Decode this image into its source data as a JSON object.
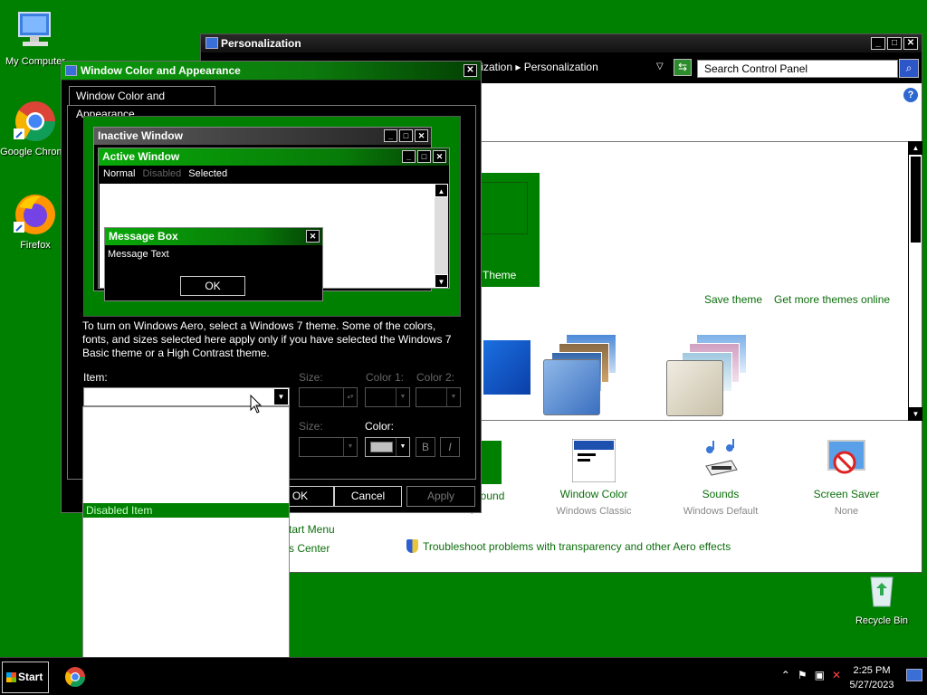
{
  "desktop": {
    "icons": [
      {
        "label": "My Computer",
        "icon": "computer-icon"
      },
      {
        "label": "Google Chrome",
        "icon": "chrome-icon"
      },
      {
        "label": "Firefox",
        "icon": "firefox-icon"
      },
      {
        "label": "Recycle Bin",
        "icon": "recycle-bin-icon"
      }
    ]
  },
  "personalization": {
    "title": "Personalization",
    "breadcrumb": "alization  ▸  Personalization",
    "search_placeholder": "Search Control Panel",
    "theme_tile_label": "Theme",
    "save_theme": "Save theme",
    "get_more_themes": "Get more themes online",
    "categories": [
      {
        "title": "Window Color",
        "subtitle": "Windows Classic"
      },
      {
        "title": "Sounds",
        "subtitle": "Windows Default"
      },
      {
        "title": "Screen Saver",
        "subtitle": "None"
      }
    ],
    "cut_background": "ground",
    "cut_background_sub": "r",
    "cut_start_menu": "tart Menu",
    "cut_center": "s Center",
    "troubleshoot": "Troubleshoot problems with transparency and other Aero effects"
  },
  "dialog": {
    "title": "Window Color and Appearance",
    "tab": "Window Color and Appearance",
    "preview": {
      "inactive_title": "Inactive Window",
      "active_title": "Active Window",
      "menu_normal": "Normal",
      "menu_disabled": "Disabled",
      "menu_selected": "Selected",
      "msgbox_title": "Message Box",
      "msgbox_text": "Message Text",
      "ok": "OK"
    },
    "description": "To turn on Windows Aero, select a Windows 7 theme.  Some of the colors, fonts, and sizes selected here apply only if you have selected the Windows 7 Basic theme or a High Contrast theme.",
    "item_label": "Item:",
    "size1_label": "Size:",
    "color1_label": "Color 1:",
    "color2_label": "Color 2:",
    "size2_label": "Size:",
    "color_label": "Color:",
    "bold": "B",
    "italic": "I",
    "ok_button": "OK",
    "cancel_button": "Cancel",
    "apply_button": "Apply",
    "dropdown_highlight": "Disabled Item",
    "color_swatch": "#c0c0c0"
  },
  "taskbar": {
    "start": "Start",
    "time": "2:25 PM",
    "date": "5/27/2023"
  },
  "colors": {
    "desktop": "#008000",
    "accent_link": "#0b6e0b",
    "highlight": "#008000"
  }
}
